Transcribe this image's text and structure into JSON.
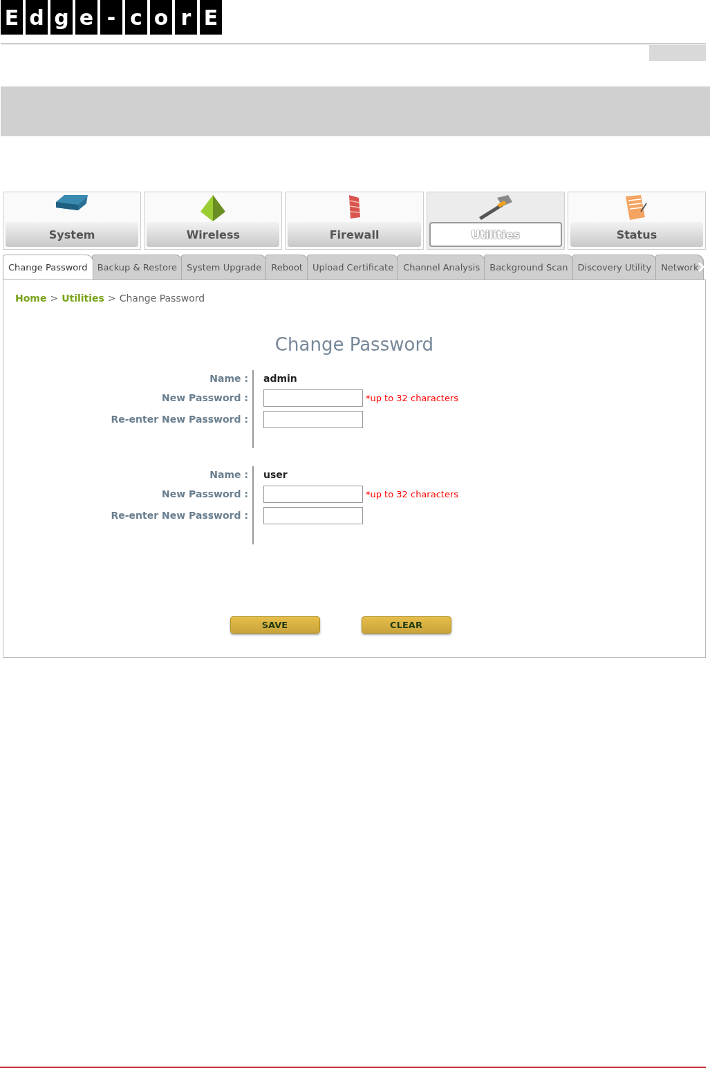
{
  "logo": {
    "letters": [
      "E",
      "d",
      "g",
      "e",
      "-",
      "c",
      "o",
      "r",
      "E"
    ]
  },
  "main_tabs": [
    {
      "label": "System",
      "selected": false
    },
    {
      "label": "Wireless",
      "selected": false
    },
    {
      "label": "Firewall",
      "selected": false
    },
    {
      "label": "Utilities",
      "selected": true
    },
    {
      "label": "Status",
      "selected": false
    }
  ],
  "sub_tabs": [
    {
      "label": "Change Password",
      "selected": true
    },
    {
      "label": "Backup & Restore",
      "selected": false
    },
    {
      "label": "System Upgrade",
      "selected": false
    },
    {
      "label": "Reboot",
      "selected": false
    },
    {
      "label": "Upload Certificate",
      "selected": false
    },
    {
      "label": "Channel Analysis",
      "selected": false
    },
    {
      "label": "Background Scan",
      "selected": false
    },
    {
      "label": "Discovery Utility",
      "selected": false
    },
    {
      "label": "Network",
      "selected": false
    }
  ],
  "breadcrumb": [
    {
      "label": "Home",
      "kind": "link"
    },
    {
      "label": "Utilities",
      "kind": "link"
    },
    {
      "label": "Change Password",
      "kind": "current"
    }
  ],
  "breadcrumb_separator": ">",
  "title": "Change Password",
  "accounts": [
    {
      "name_label": "Name :",
      "name": "admin",
      "new_label": "New Password :",
      "reenter_label": "Re-enter New Password :",
      "hint": "*up to 32 characters"
    },
    {
      "name_label": "Name :",
      "name": "user",
      "new_label": "New Password :",
      "reenter_label": "Re-enter New Password :",
      "hint": "*up to 32 characters"
    }
  ],
  "buttons": [
    "SAVE",
    "CLEAR"
  ]
}
